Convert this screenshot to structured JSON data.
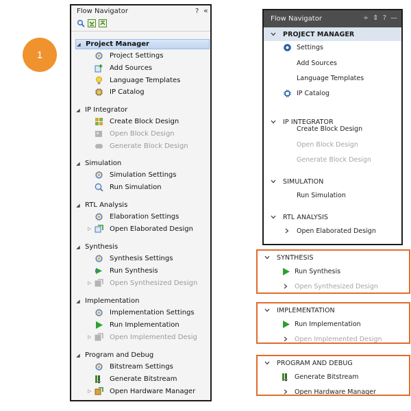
{
  "step_badge": "1",
  "left": {
    "title": "Flow Navigator",
    "help": "?",
    "collapse": "«",
    "sections": [
      {
        "label": "Project Manager",
        "selected": true,
        "items": [
          {
            "label": "Project Settings",
            "icon": "gear-icon",
            "disabled": false
          },
          {
            "label": "Add Sources",
            "icon": "add-sources-icon",
            "disabled": false
          },
          {
            "label": "Language Templates",
            "icon": "lightbulb-icon",
            "disabled": false
          },
          {
            "label": "IP Catalog",
            "icon": "chip-icon",
            "disabled": false
          }
        ]
      },
      {
        "label": "IP Integrator",
        "items": [
          {
            "label": "Create Block Design",
            "icon": "create-block-icon",
            "disabled": false
          },
          {
            "label": "Open Block Design",
            "icon": "open-block-icon",
            "disabled": true
          },
          {
            "label": "Generate Block Design",
            "icon": "generate-block-icon",
            "disabled": true
          }
        ]
      },
      {
        "label": "Simulation",
        "items": [
          {
            "label": "Simulation Settings",
            "icon": "gear-icon",
            "disabled": false
          },
          {
            "label": "Run Simulation",
            "icon": "run-simulation-icon",
            "disabled": false
          }
        ]
      },
      {
        "label": "RTL Analysis",
        "items": [
          {
            "label": "Elaboration Settings",
            "icon": "gear-icon",
            "disabled": false
          },
          {
            "label": "Open Elaborated Design",
            "icon": "open-design-icon",
            "disabled": false,
            "expandable": true
          }
        ]
      },
      {
        "label": "Synthesis",
        "items": [
          {
            "label": "Synthesis Settings",
            "icon": "gear-icon",
            "disabled": false
          },
          {
            "label": "Run Synthesis",
            "icon": "run-synthesis-icon",
            "disabled": false
          },
          {
            "label": "Open Synthesized Design",
            "icon": "open-design-icon",
            "disabled": true,
            "expandable": true
          }
        ]
      },
      {
        "label": "Implementation",
        "items": [
          {
            "label": "Implementation Settings",
            "icon": "gear-icon",
            "disabled": false
          },
          {
            "label": "Run Implementation",
            "icon": "play-icon",
            "disabled": false
          },
          {
            "label": "Open Implemented Desig",
            "icon": "open-design-icon",
            "disabled": true,
            "expandable": true
          }
        ]
      },
      {
        "label": "Program and Debug",
        "items": [
          {
            "label": "Bitstream Settings",
            "icon": "gear-icon",
            "disabled": false
          },
          {
            "label": "Generate Bitstream",
            "icon": "bitstream-icon",
            "disabled": false
          },
          {
            "label": "Open Hardware Manager",
            "icon": "hardware-manager-icon",
            "disabled": false,
            "expandable": true
          }
        ]
      }
    ]
  },
  "right": {
    "title": "Flow Navigator",
    "header_icons": [
      "÷",
      "⇕",
      "?",
      "—"
    ],
    "sections": [
      {
        "label": "PROJECT MANAGER",
        "selected": true,
        "items": [
          {
            "label": "Settings",
            "icon": "gear-icon"
          },
          {
            "label": "Add Sources"
          },
          {
            "label": "Language Templates"
          },
          {
            "label": "IP Catalog",
            "icon": "chip-icon"
          }
        ]
      },
      {
        "label": "IP INTEGRATOR",
        "items": [
          {
            "label": "Create Block Design"
          },
          {
            "label": "Open Block Design",
            "disabled": true
          },
          {
            "label": "Generate Block Design",
            "disabled": true
          }
        ]
      },
      {
        "label": "SIMULATION",
        "items": [
          {
            "label": "Run Simulation"
          }
        ]
      },
      {
        "label": "RTL ANALYSIS",
        "items": [
          {
            "label": "Open Elaborated Design",
            "expandable": true
          }
        ]
      }
    ],
    "boxes": [
      {
        "label": "SYNTHESIS",
        "items": [
          {
            "label": "Run Synthesis",
            "icon": "play-icon"
          },
          {
            "label": "Open Synthesized Design",
            "disabled": true,
            "expandable": true
          }
        ]
      },
      {
        "label": "IMPLEMENTATION",
        "items": [
          {
            "label": "Run Implementation",
            "icon": "play-icon"
          },
          {
            "label": "Open Implemented Design",
            "disabled": true,
            "expandable": true
          }
        ]
      },
      {
        "label": "PROGRAM AND DEBUG",
        "items": [
          {
            "label": "Generate Bitstream",
            "icon": "bitstream-icon"
          },
          {
            "label": "Open Hardware Manager",
            "expandable": true
          }
        ]
      }
    ]
  },
  "colors": {
    "badge": "#f0922e",
    "highlight_border": "#e26a2c",
    "header_bg": "#4d4d4d",
    "play": "#2ba12b"
  }
}
